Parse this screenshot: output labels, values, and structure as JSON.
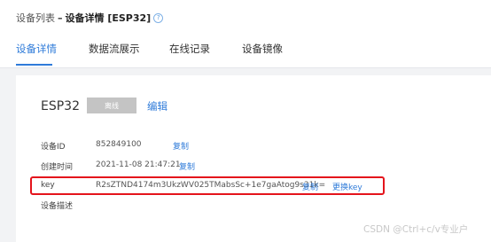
{
  "breadcrumb": {
    "parent": "设备列表",
    "separator": "–",
    "current": "设备详情 [ESP32]",
    "help_icon": "question-circle-icon"
  },
  "tabs": [
    {
      "label": "设备详情",
      "active": true
    },
    {
      "label": "数据流展示",
      "active": false
    },
    {
      "label": "在线记录",
      "active": false
    },
    {
      "label": "设备镜像",
      "active": false
    }
  ],
  "device": {
    "name": "ESP32",
    "status": "离线",
    "edit_label": "编辑"
  },
  "fields": {
    "id": {
      "label": "设备ID",
      "value": "852849100",
      "copy_label": "复制"
    },
    "created": {
      "label": "创建时间",
      "value": "2021-11-08 21:47:21",
      "copy_label": "复制"
    },
    "key": {
      "label": "key",
      "value": "R2sZTND4174m3UkzWV025TMabsSc+1e7gaAtog9s31k=",
      "copy_label": "复制",
      "change_label": "更换key"
    },
    "description": {
      "label": "设备描述",
      "value": ""
    }
  },
  "watermark": "CSDN @Ctrl+c/v专业户",
  "colors": {
    "accent": "#2f7bd9",
    "highlight_border": "#e4141c",
    "status_badge": "#c4c4c4"
  }
}
